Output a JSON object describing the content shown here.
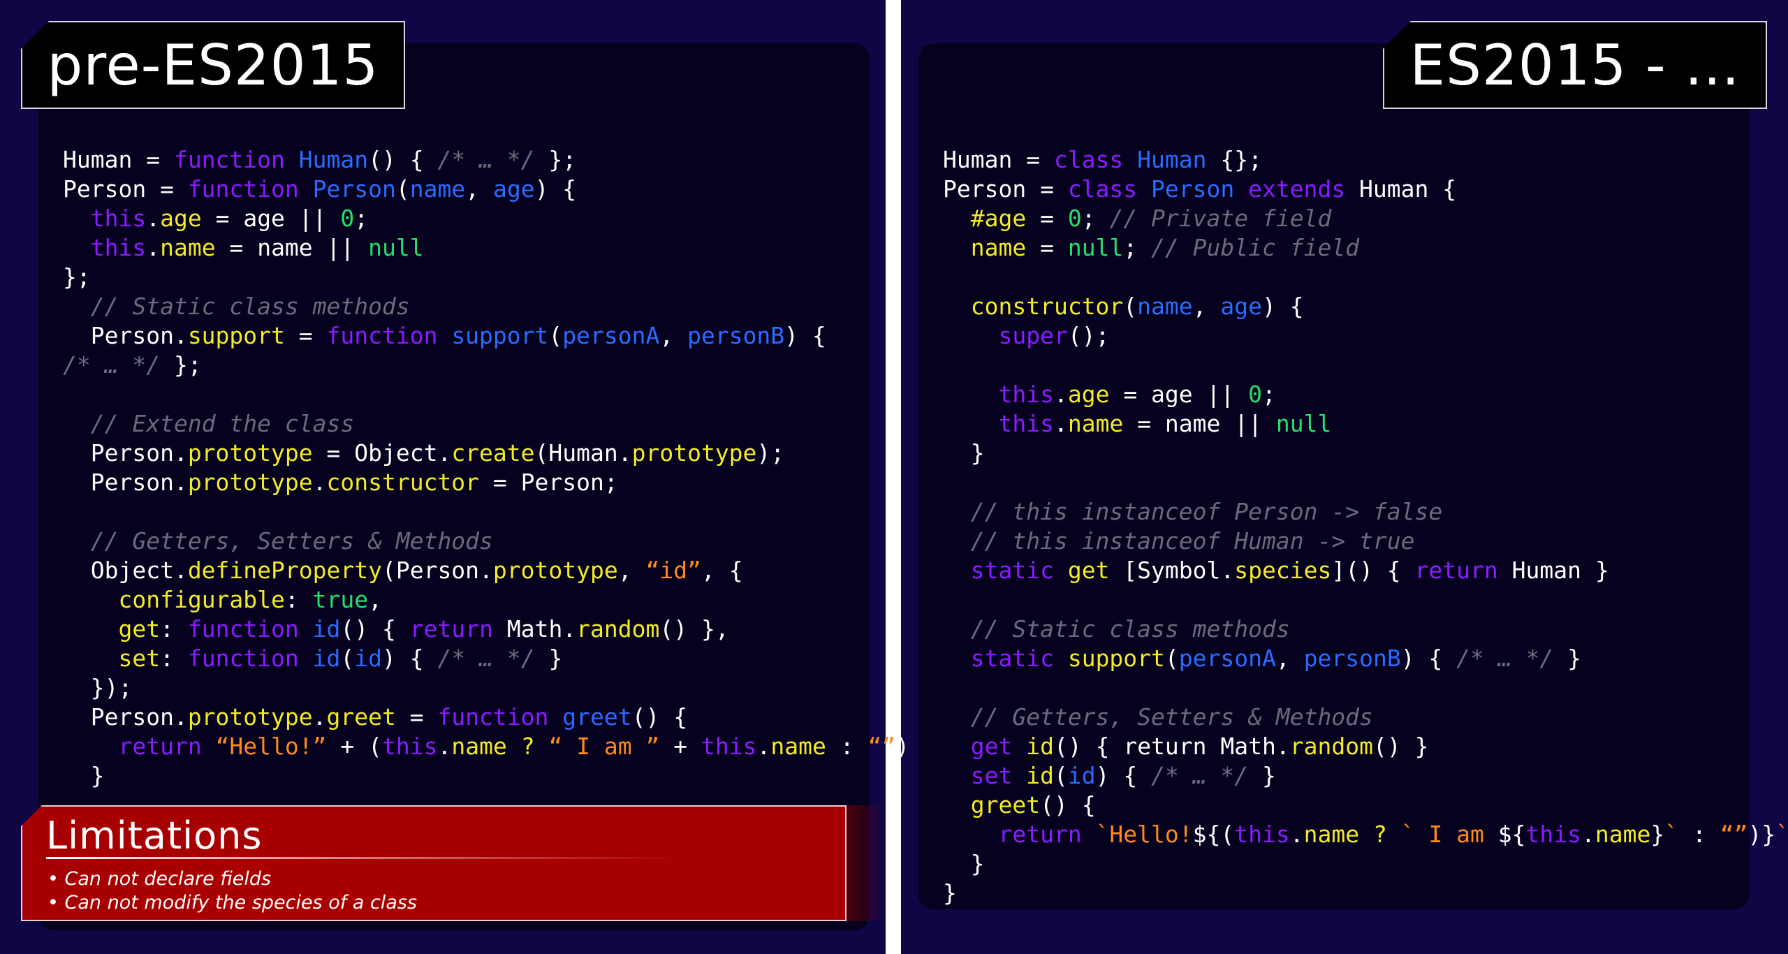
{
  "labels": {
    "left": "pre-ES2015",
    "right": "ES2015 - ..."
  },
  "colors": {
    "background": "#0f0645",
    "card": "#05011f",
    "keyword": "#8a1cff",
    "name": "#2b6bff",
    "property": "#f4ec22",
    "number": "#22e06b",
    "string": "#ff8a1a",
    "comment": "#6b6b7a",
    "limitations_bg": "#a80000"
  },
  "code_left": [
    [
      [
        "plain",
        "Human = "
      ],
      [
        "keyword",
        "function "
      ],
      [
        "name",
        "Human"
      ],
      [
        "plain",
        "() { "
      ],
      [
        "comment",
        "/* … */"
      ],
      [
        "plain",
        " };"
      ]
    ],
    [
      [
        "plain",
        "Person = "
      ],
      [
        "keyword",
        "function "
      ],
      [
        "name",
        "Person"
      ],
      [
        "plain",
        "("
      ],
      [
        "param",
        "name"
      ],
      [
        "plain",
        ", "
      ],
      [
        "param",
        "age"
      ],
      [
        "plain",
        ") {"
      ]
    ],
    [
      [
        "plain",
        "  "
      ],
      [
        "keyword",
        "this"
      ],
      [
        "plain",
        "."
      ],
      [
        "prop",
        "age"
      ],
      [
        "plain",
        " = age || "
      ],
      [
        "number",
        "0"
      ],
      [
        "plain",
        ";"
      ]
    ],
    [
      [
        "plain",
        "  "
      ],
      [
        "keyword",
        "this"
      ],
      [
        "plain",
        "."
      ],
      [
        "prop",
        "name"
      ],
      [
        "plain",
        " = name || "
      ],
      [
        "number",
        "null"
      ]
    ],
    [
      [
        "plain",
        "};"
      ]
    ],
    [
      [
        "plain",
        "  "
      ],
      [
        "comment",
        "// Static class methods"
      ]
    ],
    [
      [
        "plain",
        "  Person."
      ],
      [
        "prop",
        "support"
      ],
      [
        "plain",
        " = "
      ],
      [
        "keyword",
        "function "
      ],
      [
        "name",
        "support"
      ],
      [
        "plain",
        "("
      ],
      [
        "param",
        "personA"
      ],
      [
        "plain",
        ", "
      ],
      [
        "param",
        "personB"
      ],
      [
        "plain",
        ") {"
      ]
    ],
    [
      [
        "comment",
        "/* … */"
      ],
      [
        "plain",
        " };"
      ]
    ],
    [],
    [
      [
        "plain",
        "  "
      ],
      [
        "comment",
        "// Extend the class"
      ]
    ],
    [
      [
        "plain",
        "  Person."
      ],
      [
        "prop",
        "prototype"
      ],
      [
        "plain",
        " = Object."
      ],
      [
        "prop",
        "create"
      ],
      [
        "plain",
        "(Human."
      ],
      [
        "prop",
        "prototype"
      ],
      [
        "plain",
        ");"
      ]
    ],
    [
      [
        "plain",
        "  Person."
      ],
      [
        "prop",
        "prototype"
      ],
      [
        "plain",
        "."
      ],
      [
        "prop",
        "constructor"
      ],
      [
        "plain",
        " = Person;"
      ]
    ],
    [],
    [
      [
        "plain",
        "  "
      ],
      [
        "comment",
        "// Getters, Setters & Methods"
      ]
    ],
    [
      [
        "plain",
        "  Object."
      ],
      [
        "prop",
        "defineProperty"
      ],
      [
        "plain",
        "(Person."
      ],
      [
        "prop",
        "prototype"
      ],
      [
        "plain",
        ", "
      ],
      [
        "string",
        "“id”"
      ],
      [
        "plain",
        ", {"
      ]
    ],
    [
      [
        "plain",
        "    "
      ],
      [
        "prop",
        "configurable"
      ],
      [
        "plain",
        ": "
      ],
      [
        "number",
        "true"
      ],
      [
        "plain",
        ","
      ]
    ],
    [
      [
        "plain",
        "    "
      ],
      [
        "prop",
        "get"
      ],
      [
        "plain",
        ": "
      ],
      [
        "keyword",
        "function "
      ],
      [
        "name",
        "id"
      ],
      [
        "plain",
        "() { "
      ],
      [
        "keyword",
        "return"
      ],
      [
        "plain",
        " Math."
      ],
      [
        "prop",
        "random"
      ],
      [
        "plain",
        "() },"
      ]
    ],
    [
      [
        "plain",
        "    "
      ],
      [
        "prop",
        "set"
      ],
      [
        "plain",
        ": "
      ],
      [
        "keyword",
        "function "
      ],
      [
        "name",
        "id"
      ],
      [
        "plain",
        "("
      ],
      [
        "param",
        "id"
      ],
      [
        "plain",
        ") { "
      ],
      [
        "comment",
        "/* … */"
      ],
      [
        "plain",
        " }"
      ]
    ],
    [
      [
        "plain",
        "  });"
      ]
    ],
    [
      [
        "plain",
        "  Person."
      ],
      [
        "prop",
        "prototype"
      ],
      [
        "plain",
        "."
      ],
      [
        "prop",
        "greet"
      ],
      [
        "plain",
        " = "
      ],
      [
        "keyword",
        "function "
      ],
      [
        "name",
        "greet"
      ],
      [
        "plain",
        "() {"
      ]
    ],
    [
      [
        "plain",
        "    "
      ],
      [
        "keyword",
        "return "
      ],
      [
        "string",
        "“Hello!”"
      ],
      [
        "plain",
        " + ("
      ],
      [
        "keyword",
        "this"
      ],
      [
        "plain",
        "."
      ],
      [
        "prop",
        "name"
      ],
      [
        "prop",
        " ? "
      ],
      [
        "string",
        "“ I am ”"
      ],
      [
        "plain",
        " + "
      ],
      [
        "keyword",
        "this"
      ],
      [
        "plain",
        "."
      ],
      [
        "prop",
        "name"
      ],
      [
        "plain",
        " : "
      ],
      [
        "string",
        "“”"
      ],
      [
        "plain",
        ")"
      ]
    ],
    [
      [
        "plain",
        "  }"
      ]
    ]
  ],
  "code_right": [
    [
      [
        "plain",
        "Human = "
      ],
      [
        "keyword",
        "class "
      ],
      [
        "name",
        "Human"
      ],
      [
        "plain",
        " {};"
      ]
    ],
    [
      [
        "plain",
        "Person = "
      ],
      [
        "keyword",
        "class "
      ],
      [
        "name",
        "Person "
      ],
      [
        "keyword",
        "extends"
      ],
      [
        "plain",
        " Human {"
      ]
    ],
    [
      [
        "plain",
        "  "
      ],
      [
        "prop",
        "#age"
      ],
      [
        "plain",
        " = "
      ],
      [
        "number",
        "0"
      ],
      [
        "plain",
        "; "
      ],
      [
        "comment",
        "// Private field"
      ]
    ],
    [
      [
        "plain",
        "  "
      ],
      [
        "prop",
        "name"
      ],
      [
        "plain",
        " = "
      ],
      [
        "number",
        "null"
      ],
      [
        "plain",
        "; "
      ],
      [
        "comment",
        "// Public field"
      ]
    ],
    [],
    [
      [
        "plain",
        "  "
      ],
      [
        "prop",
        "constructor"
      ],
      [
        "plain",
        "("
      ],
      [
        "param",
        "name"
      ],
      [
        "plain",
        ", "
      ],
      [
        "param",
        "age"
      ],
      [
        "plain",
        ") {"
      ]
    ],
    [
      [
        "plain",
        "    "
      ],
      [
        "keyword",
        "super"
      ],
      [
        "plain",
        "();"
      ]
    ],
    [],
    [
      [
        "plain",
        "    "
      ],
      [
        "keyword",
        "this"
      ],
      [
        "plain",
        "."
      ],
      [
        "prop",
        "age"
      ],
      [
        "plain",
        " = age || "
      ],
      [
        "number",
        "0"
      ],
      [
        "plain",
        ";"
      ]
    ],
    [
      [
        "plain",
        "    "
      ],
      [
        "keyword",
        "this"
      ],
      [
        "plain",
        "."
      ],
      [
        "prop",
        "name"
      ],
      [
        "plain",
        " = name || "
      ],
      [
        "number",
        "null"
      ]
    ],
    [
      [
        "plain",
        "  }"
      ]
    ],
    [],
    [
      [
        "plain",
        "  "
      ],
      [
        "comment",
        "// this instanceof Person -> false"
      ]
    ],
    [
      [
        "plain",
        "  "
      ],
      [
        "comment",
        "// this instanceof Human -> true"
      ]
    ],
    [
      [
        "plain",
        "  "
      ],
      [
        "keyword",
        "static "
      ],
      [
        "prop",
        "get"
      ],
      [
        "plain",
        " [Symbol."
      ],
      [
        "prop",
        "species"
      ],
      [
        "plain",
        "]() { "
      ],
      [
        "keyword",
        "return"
      ],
      [
        "plain",
        " Human }"
      ]
    ],
    [],
    [
      [
        "plain",
        "  "
      ],
      [
        "comment",
        "// Static class methods"
      ]
    ],
    [
      [
        "plain",
        "  "
      ],
      [
        "keyword",
        "static "
      ],
      [
        "prop",
        "support"
      ],
      [
        "plain",
        "("
      ],
      [
        "param",
        "personA"
      ],
      [
        "plain",
        ", "
      ],
      [
        "param",
        "personB"
      ],
      [
        "plain",
        ") { "
      ],
      [
        "comment",
        "/* … */"
      ],
      [
        "plain",
        " }"
      ]
    ],
    [],
    [
      [
        "plain",
        "  "
      ],
      [
        "comment",
        "// Getters, Setters & Methods"
      ]
    ],
    [
      [
        "plain",
        "  "
      ],
      [
        "keyword",
        "get "
      ],
      [
        "prop",
        "id"
      ],
      [
        "plain",
        "() { return Math."
      ],
      [
        "prop",
        "random"
      ],
      [
        "plain",
        "() }"
      ]
    ],
    [
      [
        "plain",
        "  "
      ],
      [
        "keyword",
        "set "
      ],
      [
        "prop",
        "id"
      ],
      [
        "plain",
        "("
      ],
      [
        "param",
        "id"
      ],
      [
        "plain",
        ") { "
      ],
      [
        "comment",
        "/* … */"
      ],
      [
        "plain",
        " }"
      ]
    ],
    [
      [
        "plain",
        "  "
      ],
      [
        "prop",
        "greet"
      ],
      [
        "plain",
        "() {"
      ]
    ],
    [
      [
        "plain",
        "    "
      ],
      [
        "keyword",
        "return "
      ],
      [
        "string",
        "`Hello!"
      ],
      [
        "plain",
        "${("
      ],
      [
        "keyword",
        "this"
      ],
      [
        "plain",
        "."
      ],
      [
        "prop",
        "name"
      ],
      [
        "prop",
        " ? "
      ],
      [
        "string",
        "` I am "
      ],
      [
        "plain",
        "${"
      ],
      [
        "keyword",
        "this"
      ],
      [
        "plain",
        "."
      ],
      [
        "prop",
        "name"
      ],
      [
        "plain",
        "}"
      ],
      [
        "string",
        "`"
      ],
      [
        "plain",
        " : "
      ],
      [
        "string",
        "“”"
      ],
      [
        "plain",
        ")}"
      ],
      [
        "string",
        "`"
      ]
    ],
    [
      [
        "plain",
        "  }"
      ]
    ],
    [
      [
        "plain",
        "}"
      ]
    ]
  ],
  "limitations": {
    "title": "Limitations",
    "items": [
      "• Can not declare fields",
      "• Can not modify the species of a class"
    ]
  }
}
